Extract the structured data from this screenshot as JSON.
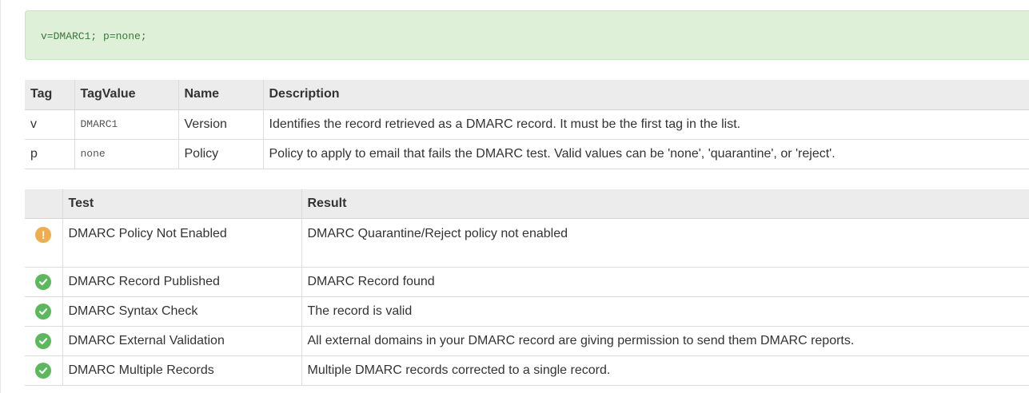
{
  "record": {
    "text": "v=DMARC1; p=none;"
  },
  "tag_table": {
    "headers": {
      "tag": "Tag",
      "tag_value": "TagValue",
      "name": "Name",
      "description": "Description"
    },
    "rows": [
      {
        "tag": "v",
        "tag_value": "DMARC1",
        "name": "Version",
        "description": "Identifies the record retrieved as a DMARC record. It must be the first tag in the list."
      },
      {
        "tag": "p",
        "tag_value": "none",
        "name": "Policy",
        "description": "Policy to apply to email that fails the DMARC test. Valid values can be 'none', 'quarantine', or 'reject'."
      }
    ]
  },
  "test_table": {
    "headers": {
      "status": "",
      "test": "Test",
      "result": "Result"
    },
    "rows": [
      {
        "status": "warning",
        "icon": "warning-icon",
        "test": "DMARC Policy Not Enabled",
        "result": "DMARC Quarantine/Reject policy not enabled"
      },
      {
        "status": "pass",
        "icon": "check-icon",
        "test": "DMARC Record Published",
        "result": "DMARC Record found"
      },
      {
        "status": "pass",
        "icon": "check-icon",
        "test": "DMARC Syntax Check",
        "result": "The record is valid"
      },
      {
        "status": "pass",
        "icon": "check-icon",
        "test": "DMARC External Validation",
        "result": "All external domains in your DMARC record are giving permission to send them DMARC reports."
      },
      {
        "status": "pass",
        "icon": "check-icon",
        "test": "DMARC Multiple Records",
        "result": "Multiple DMARC records corrected to a single record."
      }
    ]
  },
  "colors": {
    "warning": "#f0ad4e",
    "pass": "#5cb85c",
    "record_bg": "#dff0d8",
    "record_text": "#3c763d",
    "header_bg": "#ececec"
  }
}
